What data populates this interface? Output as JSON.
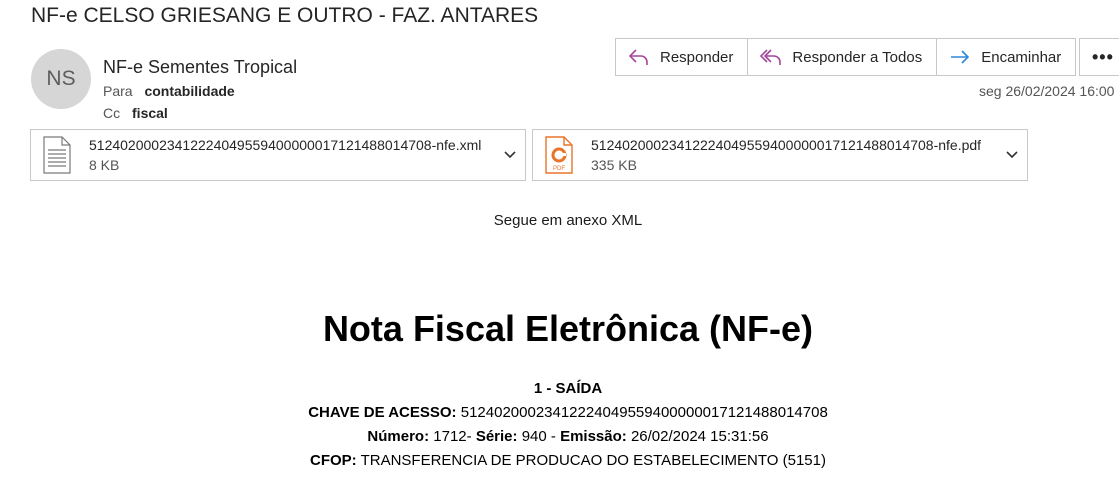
{
  "email": {
    "subject": "NF-e CELSO GRIESANG E OUTRO - FAZ. ANTARES",
    "avatar_initials": "NS",
    "sender": "NF-e Sementes Tropical",
    "to_label": "Para",
    "to_value": "contabilidade",
    "cc_label": "Cc",
    "cc_value": "fiscal",
    "date": "seg 26/02/2024 16:00"
  },
  "actions": {
    "reply": "Responder",
    "reply_all": "Responder a Todos",
    "forward": "Encaminhar",
    "more": "•••"
  },
  "attachments": [
    {
      "name": "51240200023412224049559400000017121488014708-nfe.xml",
      "size": "8 KB",
      "icon": "xml-file-icon"
    },
    {
      "name": "51240200023412224049559400000017121488014708-nfe.pdf",
      "size": "335 KB",
      "icon": "pdf-file-icon"
    }
  ],
  "body": {
    "intro": "Segue em anexo XML",
    "title": "Nota Fiscal Eletrônica (NF-e)",
    "tipo": "1 - SAÍDA",
    "chave_label": "CHAVE DE ACESSO:",
    "chave_value": "51240200023412224049559400000017121488014708",
    "numero_label": "Número:",
    "numero_value": "1712-",
    "serie_label": "Série:",
    "serie_value": "940 -",
    "emissao_label": "Emissão:",
    "emissao_value": "26/02/2024 15:31:56",
    "cfop_label": "CFOP:",
    "cfop_value": "TRANSFERENCIA DE PRODUCAO DO ESTABELECIMENTO (5151)"
  },
  "colors": {
    "reply_icon": "#a4479b",
    "forward_icon": "#2b88d8",
    "pdf_icon": "#e8742a",
    "border": "#c8c8c8"
  }
}
